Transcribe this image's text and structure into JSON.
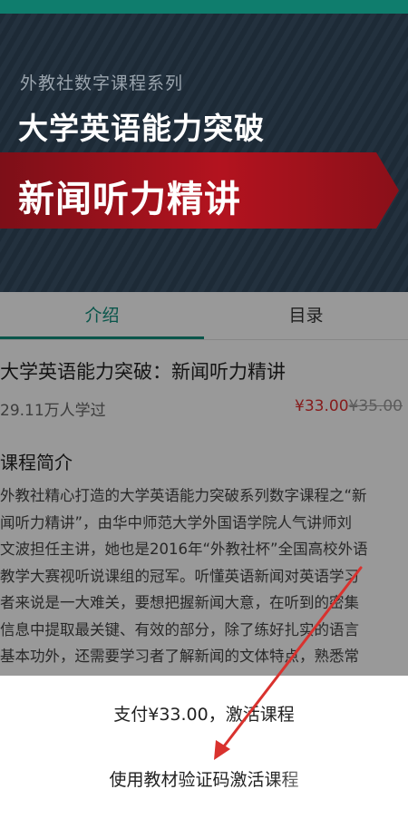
{
  "banner": {
    "series": "外教社数字课程系列",
    "title": "大学英语能力突破",
    "ribbon_text": "新闻听力精讲"
  },
  "tabs": [
    {
      "label": "介绍",
      "active": true
    },
    {
      "label": "目录",
      "active": false
    }
  ],
  "course": {
    "title": "大学英语能力突破：新闻听力精讲",
    "learners": "29.11万人学过",
    "price_now": "¥33.00",
    "price_old": "¥35.00"
  },
  "intro": {
    "heading": "课程简介",
    "lines": [
      "外教社精心打造的大学英语能力突破系列数字课程之“新",
      "闻听力精讲”，由华中师范大学外国语学院人气讲师刘",
      "文波担任主讲，她也是2016年“外教社杯”全国高校外语",
      "教学大赛视听说课组的冠军。听懂英语新闻对英语学习",
      "者来说是一大难关，要想把握新闻大意，在听到的密集",
      "信息中提取最关键、有效的部分，除了练好扎实的语言",
      "基本功外，还需要学习者了解新闻的文体特点，熟悉常"
    ]
  },
  "sheet": {
    "pay_label": "支付¥33.00，激活课程",
    "code_label": "使用教材验证码激活课程"
  },
  "colors": {
    "accent": "#0f8e7c",
    "price": "#e0302f",
    "annotation_arrow": "#d9322e"
  }
}
